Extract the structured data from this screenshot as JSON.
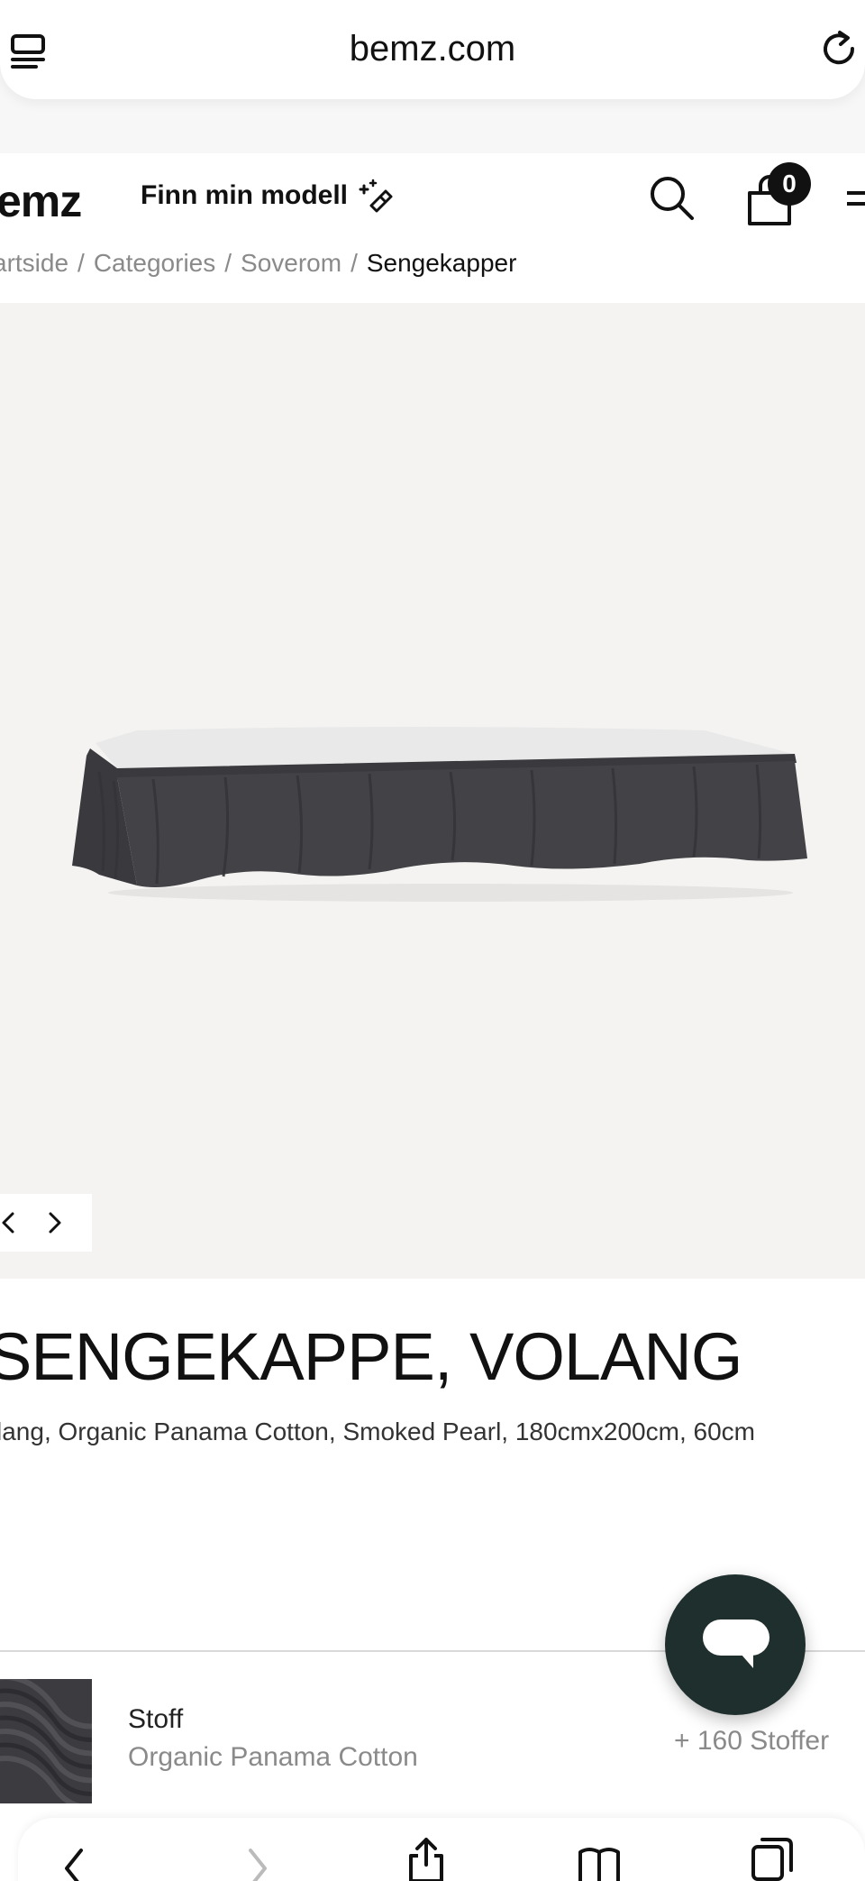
{
  "browser": {
    "url": "bemz.com"
  },
  "header": {
    "logo": "emz",
    "find_model": "Finn min modell",
    "cart_count": "0"
  },
  "breadcrumb": {
    "items": [
      "artside",
      "Categories",
      "Soverom"
    ],
    "current": "Sengekapper"
  },
  "product": {
    "title": "SENGEKAPPE, VOLANG",
    "subtitle": "lang, Organic Panama Cotton, Smoked Pearl, 180cmx200cm, 60cm"
  },
  "fabric": {
    "label": "Stoff",
    "value": "Organic Panama Cotton",
    "more": "+ 160 Stoffer"
  },
  "colors": {
    "chat_button": "#1f2f2d",
    "gallery_bg": "#f4f3f1",
    "fabric_color": "#3c3b3f"
  },
  "icons": [
    "tabs-icon",
    "reload-icon",
    "wand-icon",
    "search-icon",
    "bag-icon",
    "menu-icon",
    "chevron-left-icon",
    "chevron-right-icon",
    "chat-icon",
    "back-icon",
    "forward-icon",
    "share-icon",
    "bookmarks-icon",
    "tabs-overview-icon"
  ]
}
